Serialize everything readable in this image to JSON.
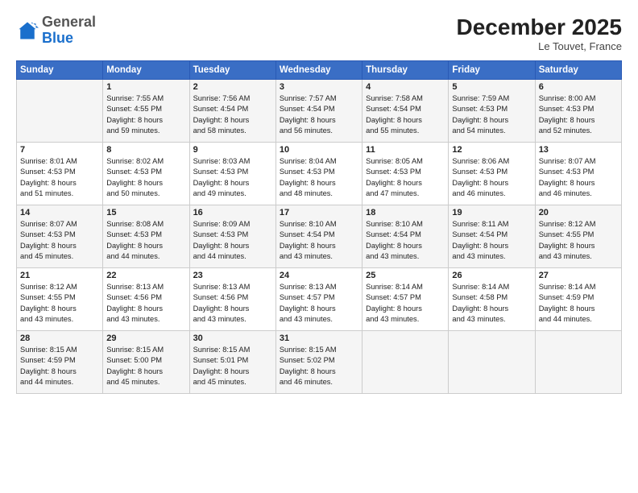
{
  "header": {
    "logo_general": "General",
    "logo_blue": "Blue",
    "month_title": "December 2025",
    "location": "Le Touvet, France"
  },
  "days_of_week": [
    "Sunday",
    "Monday",
    "Tuesday",
    "Wednesday",
    "Thursday",
    "Friday",
    "Saturday"
  ],
  "weeks": [
    [
      {
        "day": "",
        "info": ""
      },
      {
        "day": "1",
        "info": "Sunrise: 7:55 AM\nSunset: 4:55 PM\nDaylight: 8 hours\nand 59 minutes."
      },
      {
        "day": "2",
        "info": "Sunrise: 7:56 AM\nSunset: 4:54 PM\nDaylight: 8 hours\nand 58 minutes."
      },
      {
        "day": "3",
        "info": "Sunrise: 7:57 AM\nSunset: 4:54 PM\nDaylight: 8 hours\nand 56 minutes."
      },
      {
        "day": "4",
        "info": "Sunrise: 7:58 AM\nSunset: 4:54 PM\nDaylight: 8 hours\nand 55 minutes."
      },
      {
        "day": "5",
        "info": "Sunrise: 7:59 AM\nSunset: 4:53 PM\nDaylight: 8 hours\nand 54 minutes."
      },
      {
        "day": "6",
        "info": "Sunrise: 8:00 AM\nSunset: 4:53 PM\nDaylight: 8 hours\nand 52 minutes."
      }
    ],
    [
      {
        "day": "7",
        "info": "Sunrise: 8:01 AM\nSunset: 4:53 PM\nDaylight: 8 hours\nand 51 minutes."
      },
      {
        "day": "8",
        "info": "Sunrise: 8:02 AM\nSunset: 4:53 PM\nDaylight: 8 hours\nand 50 minutes."
      },
      {
        "day": "9",
        "info": "Sunrise: 8:03 AM\nSunset: 4:53 PM\nDaylight: 8 hours\nand 49 minutes."
      },
      {
        "day": "10",
        "info": "Sunrise: 8:04 AM\nSunset: 4:53 PM\nDaylight: 8 hours\nand 48 minutes."
      },
      {
        "day": "11",
        "info": "Sunrise: 8:05 AM\nSunset: 4:53 PM\nDaylight: 8 hours\nand 47 minutes."
      },
      {
        "day": "12",
        "info": "Sunrise: 8:06 AM\nSunset: 4:53 PM\nDaylight: 8 hours\nand 46 minutes."
      },
      {
        "day": "13",
        "info": "Sunrise: 8:07 AM\nSunset: 4:53 PM\nDaylight: 8 hours\nand 46 minutes."
      }
    ],
    [
      {
        "day": "14",
        "info": "Sunrise: 8:07 AM\nSunset: 4:53 PM\nDaylight: 8 hours\nand 45 minutes."
      },
      {
        "day": "15",
        "info": "Sunrise: 8:08 AM\nSunset: 4:53 PM\nDaylight: 8 hours\nand 44 minutes."
      },
      {
        "day": "16",
        "info": "Sunrise: 8:09 AM\nSunset: 4:53 PM\nDaylight: 8 hours\nand 44 minutes."
      },
      {
        "day": "17",
        "info": "Sunrise: 8:10 AM\nSunset: 4:54 PM\nDaylight: 8 hours\nand 43 minutes."
      },
      {
        "day": "18",
        "info": "Sunrise: 8:10 AM\nSunset: 4:54 PM\nDaylight: 8 hours\nand 43 minutes."
      },
      {
        "day": "19",
        "info": "Sunrise: 8:11 AM\nSunset: 4:54 PM\nDaylight: 8 hours\nand 43 minutes."
      },
      {
        "day": "20",
        "info": "Sunrise: 8:12 AM\nSunset: 4:55 PM\nDaylight: 8 hours\nand 43 minutes."
      }
    ],
    [
      {
        "day": "21",
        "info": "Sunrise: 8:12 AM\nSunset: 4:55 PM\nDaylight: 8 hours\nand 43 minutes."
      },
      {
        "day": "22",
        "info": "Sunrise: 8:13 AM\nSunset: 4:56 PM\nDaylight: 8 hours\nand 43 minutes."
      },
      {
        "day": "23",
        "info": "Sunrise: 8:13 AM\nSunset: 4:56 PM\nDaylight: 8 hours\nand 43 minutes."
      },
      {
        "day": "24",
        "info": "Sunrise: 8:13 AM\nSunset: 4:57 PM\nDaylight: 8 hours\nand 43 minutes."
      },
      {
        "day": "25",
        "info": "Sunrise: 8:14 AM\nSunset: 4:57 PM\nDaylight: 8 hours\nand 43 minutes."
      },
      {
        "day": "26",
        "info": "Sunrise: 8:14 AM\nSunset: 4:58 PM\nDaylight: 8 hours\nand 43 minutes."
      },
      {
        "day": "27",
        "info": "Sunrise: 8:14 AM\nSunset: 4:59 PM\nDaylight: 8 hours\nand 44 minutes."
      }
    ],
    [
      {
        "day": "28",
        "info": "Sunrise: 8:15 AM\nSunset: 4:59 PM\nDaylight: 8 hours\nand 44 minutes."
      },
      {
        "day": "29",
        "info": "Sunrise: 8:15 AM\nSunset: 5:00 PM\nDaylight: 8 hours\nand 45 minutes."
      },
      {
        "day": "30",
        "info": "Sunrise: 8:15 AM\nSunset: 5:01 PM\nDaylight: 8 hours\nand 45 minutes."
      },
      {
        "day": "31",
        "info": "Sunrise: 8:15 AM\nSunset: 5:02 PM\nDaylight: 8 hours\nand 46 minutes."
      },
      {
        "day": "",
        "info": ""
      },
      {
        "day": "",
        "info": ""
      },
      {
        "day": "",
        "info": ""
      }
    ]
  ]
}
